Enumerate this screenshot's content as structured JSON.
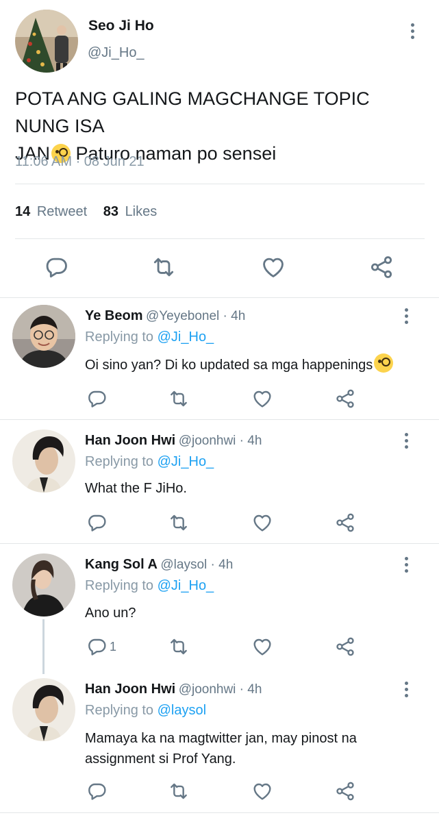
{
  "main_tweet": {
    "name": "Seo Ji Ho",
    "handle": "@Ji_Ho_",
    "text_line1": "POTA ANG GALING MAGCHANGE TOPIC NUNG ISA",
    "text_line2_a": "JAN",
    "text_line2_b": " Paturo naman po sensei",
    "timestamp": "11:06 AM · 08 Jun 21",
    "retweet_count": "14",
    "retweet_label": "Retweet",
    "like_count": "83",
    "like_label": "Likes"
  },
  "replies": [
    {
      "name": "Ye Beom",
      "meta": "@Yeyebonel · 4h",
      "replying_label": "Replying to",
      "replying_handle": "@Ji_Ho_",
      "text": "Oi sino yan? Di ko updated sa mga happenings"
    },
    {
      "name": "Han Joon Hwi",
      "meta": "@joonhwi · 4h",
      "replying_label": "Replying to",
      "replying_handle": "@Ji_Ho_",
      "text": "What the F JiHo."
    },
    {
      "name": "Kang Sol A",
      "meta": "@laysol · 4h",
      "replying_label": "Replying to",
      "replying_handle": "@Ji_Ho_",
      "text": "Ano un?",
      "reply_count": "1"
    },
    {
      "name": "Han Joon Hwi",
      "meta": "@joonhwi · 4h",
      "replying_label": "Replying to",
      "replying_handle": "@laysol",
      "text_line1": "Mamaya ka na magtwitter jan, may pinost na",
      "text_line2": "assignment si Prof Yang."
    }
  ],
  "icons": [
    "reply-icon",
    "retweet-icon",
    "like-icon",
    "share-icon",
    "more-options-icon"
  ],
  "colors": {
    "link": "#1da1f2",
    "icon": "#657786",
    "text": "#14171a",
    "divider": "#e3e6e8"
  }
}
